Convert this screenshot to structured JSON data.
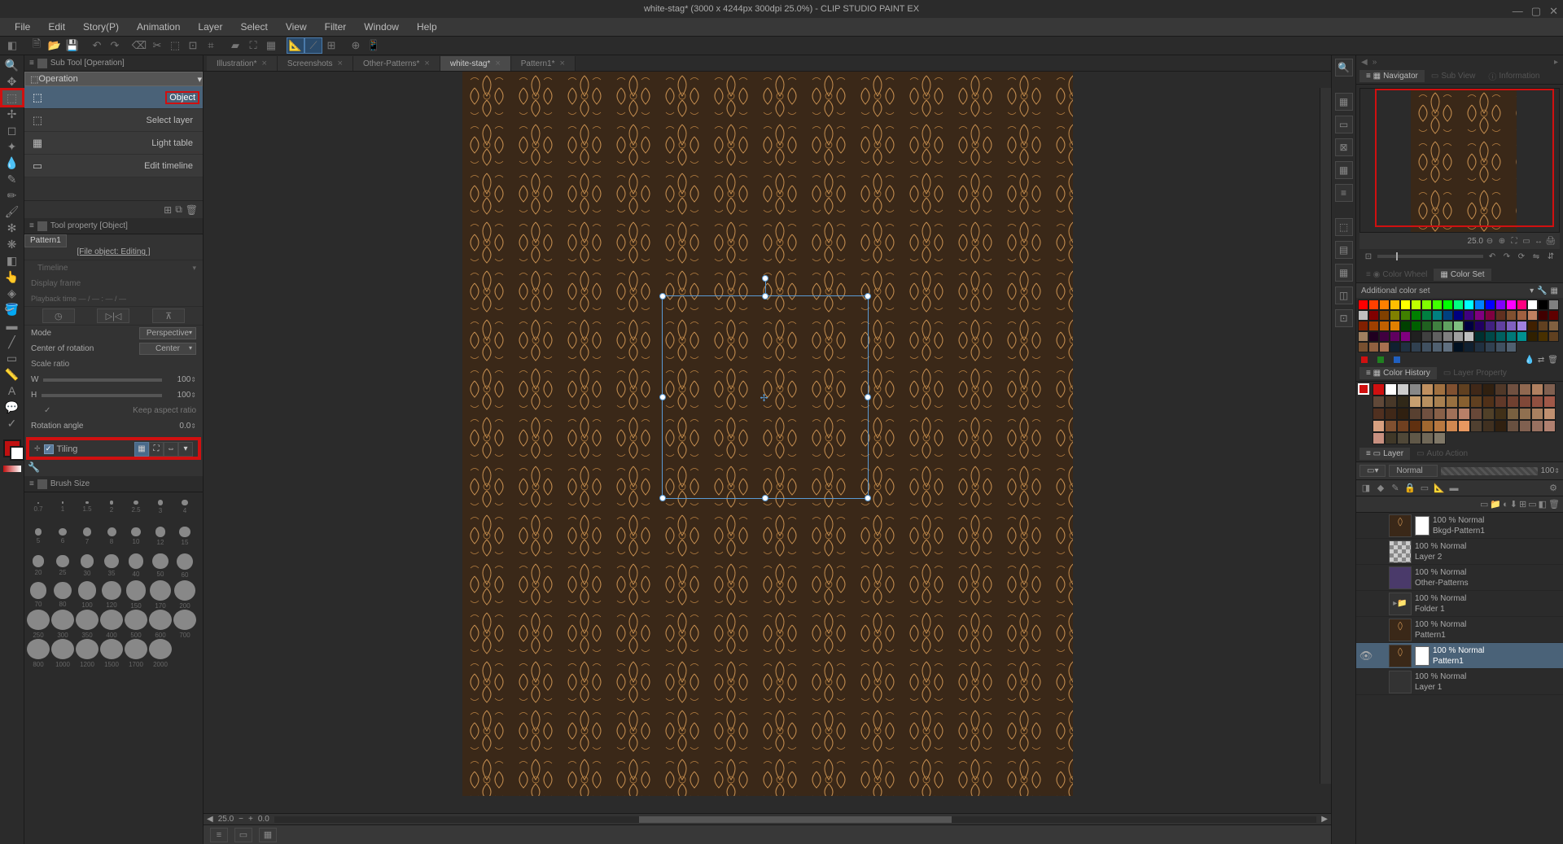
{
  "app": {
    "title": "white-stag* (3000 x 4244px 300dpi 25.0%)  -  CLIP STUDIO PAINT EX"
  },
  "menu": [
    "File",
    "Edit",
    "Story(P)",
    "Animation",
    "Layer",
    "Select",
    "View",
    "Filter",
    "Window",
    "Help"
  ],
  "doc_tabs": [
    {
      "label": "Illustration*",
      "active": false
    },
    {
      "label": "Screenshots",
      "active": false
    },
    {
      "label": "Other-Patterns*",
      "active": false
    },
    {
      "label": "white-stag*",
      "active": true
    },
    {
      "label": "Pattern1*",
      "active": false
    }
  ],
  "subtool_panel": {
    "title": "Sub Tool [Operation]",
    "group": "Operation",
    "items": [
      {
        "label": "Object",
        "selected": true
      },
      {
        "label": "Select layer",
        "selected": false
      },
      {
        "label": "Light table",
        "selected": false
      },
      {
        "label": "Edit timeline",
        "selected": false
      }
    ]
  },
  "tool_property": {
    "title": "Tool property [Object]",
    "tab": "Pattern1",
    "file_link": "[File object: Editing ]",
    "timeline_label": "Timeline",
    "display_frame": "Display frame",
    "playback": "Playback time — / — : — / —",
    "mode_label": "Mode",
    "mode_value": "Perspective",
    "center_label": "Center of rotation",
    "center_value": "Center",
    "scale_label": "Scale ratio",
    "scale_w": "W",
    "scale_w_val": "100",
    "scale_h": "H",
    "scale_h_val": "100",
    "keep_aspect": "Keep aspect ratio",
    "rotation_label": "Rotation angle",
    "rotation_val": "0.0",
    "tiling_label": "Tiling"
  },
  "brush_panel": {
    "title": "Brush Size",
    "header": [
      "0.7",
      "1",
      "1.5",
      "2",
      "2.5",
      "3",
      "4",
      "5",
      "6",
      "7",
      "8",
      "10",
      "12",
      "15",
      "20",
      "25",
      "30",
      "35",
      "40",
      "50",
      "60",
      "70",
      "80",
      "100",
      "120",
      "150",
      "170",
      "200",
      "250",
      "300",
      "350",
      "400",
      "500",
      "600",
      "700",
      "800",
      "1000",
      "1200",
      "1500",
      "1700",
      "2000"
    ]
  },
  "zoom_status": {
    "zoom": "25.0",
    "angle": "0.0"
  },
  "navigator": {
    "title": "Navigator",
    "sub_view": "Sub View",
    "info": "Information",
    "zoom": "25.0"
  },
  "color_wheel_tab": "Color Wheel",
  "color_set_tab": "Color Set",
  "color_set_header": "Additional color set",
  "color_history_tab": "Color History",
  "layer_property_tab": "Layer Property",
  "layer_panel": {
    "tab": "Layer",
    "auto_action": "Auto Action",
    "blend": "Normal",
    "opacity": "100",
    "layers": [
      {
        "blend": "100 % Normal",
        "name": "Bkgd-Pattern1",
        "thumb": "pat",
        "mask": true,
        "vis": false,
        "sel": false
      },
      {
        "blend": "100 % Normal",
        "name": "Layer 2",
        "thumb": "chk",
        "mask": false,
        "vis": false,
        "sel": false
      },
      {
        "blend": "100 % Normal",
        "name": "Other-Patterns",
        "thumb": "purp",
        "mask": false,
        "vis": false,
        "sel": false
      },
      {
        "blend": "100 % Normal",
        "name": "Folder 1",
        "thumb": "",
        "mask": false,
        "vis": false,
        "sel": false,
        "folder": true
      },
      {
        "blend": "100 % Normal",
        "name": "Pattern1",
        "thumb": "pat",
        "mask": false,
        "vis": false,
        "sel": false
      },
      {
        "blend": "100 % Normal",
        "name": "Pattern1",
        "thumb": "pat",
        "mask": true,
        "vis": true,
        "sel": true
      },
      {
        "blend": "100 % Normal",
        "name": "Layer 1",
        "thumb": "",
        "mask": false,
        "vis": false,
        "sel": false
      }
    ]
  },
  "color_swatches_1": [
    "#ff0000",
    "#ff4000",
    "#ff8000",
    "#ffbf00",
    "#ffff00",
    "#bfff00",
    "#80ff00",
    "#40ff00",
    "#00ff00",
    "#00ff80",
    "#00ffff",
    "#0080ff",
    "#0000ff",
    "#8000ff",
    "#ff00ff",
    "#ff0080",
    "#ffffff",
    "#000000",
    "#808080",
    "#c0c0c0",
    "#800000",
    "#804000",
    "#808000",
    "#408000",
    "#008000",
    "#008040",
    "#008080",
    "#004080",
    "#000080",
    "#400080",
    "#800080",
    "#800040",
    "#603020",
    "#805030",
    "#a06040",
    "#c08060",
    "#400000",
    "#600000",
    "#802000",
    "#a04000",
    "#c06000",
    "#e08000",
    "#004000",
    "#006000",
    "#206020",
    "#408040",
    "#60a060",
    "#80c080",
    "#000040",
    "#200060",
    "#402080",
    "#6040a0",
    "#8060c0",
    "#a080e0",
    "#402000",
    "#604020",
    "#806040",
    "#a08060",
    "#200020",
    "#400040",
    "#600060",
    "#800080",
    "#202020",
    "#404040",
    "#606060",
    "#808080",
    "#a0a0a0",
    "#c0c0c0",
    "#003030",
    "#004848",
    "#006060",
    "#007878",
    "#009090",
    "#302000",
    "#483000",
    "#604020",
    "#785030",
    "#906040",
    "#a87050",
    "#102030",
    "#203040",
    "#304050",
    "#405060",
    "#506070",
    "#607080",
    "#001020",
    "#102030",
    "#203040",
    "#304050",
    "#405060",
    "#506070"
  ],
  "color_history": [
    "#d01010",
    "#ffffff",
    "#cccccc",
    "#888888",
    "#c09060",
    "#a07040",
    "#805030",
    "#604020",
    "#402818",
    "#302010",
    "#503828",
    "#705040",
    "#906850",
    "#b08060",
    "#806050",
    "#604838",
    "#483828",
    "#302818",
    "#c8a070",
    "#b89060",
    "#a88050",
    "#987040",
    "#886030",
    "#604020",
    "#503018",
    "#603828",
    "#704030",
    "#804838",
    "#905040",
    "#a05848",
    "#503020",
    "#402818",
    "#302010",
    "#584030",
    "#705040",
    "#886048",
    "#a07058",
    "#b88068",
    "#684838",
    "#504028",
    "#403018",
    "#786040",
    "#907050",
    "#a88060",
    "#c09070",
    "#d8a080",
    "#805030",
    "#704020",
    "#603010",
    "#a06830",
    "#b87840",
    "#d08850",
    "#e89860",
    "#504030",
    "#403020",
    "#302010",
    "#685040",
    "#806050",
    "#987060",
    "#b08070",
    "#c89080",
    "#403828",
    "#504838",
    "#605848",
    "#706858",
    "#807868"
  ]
}
